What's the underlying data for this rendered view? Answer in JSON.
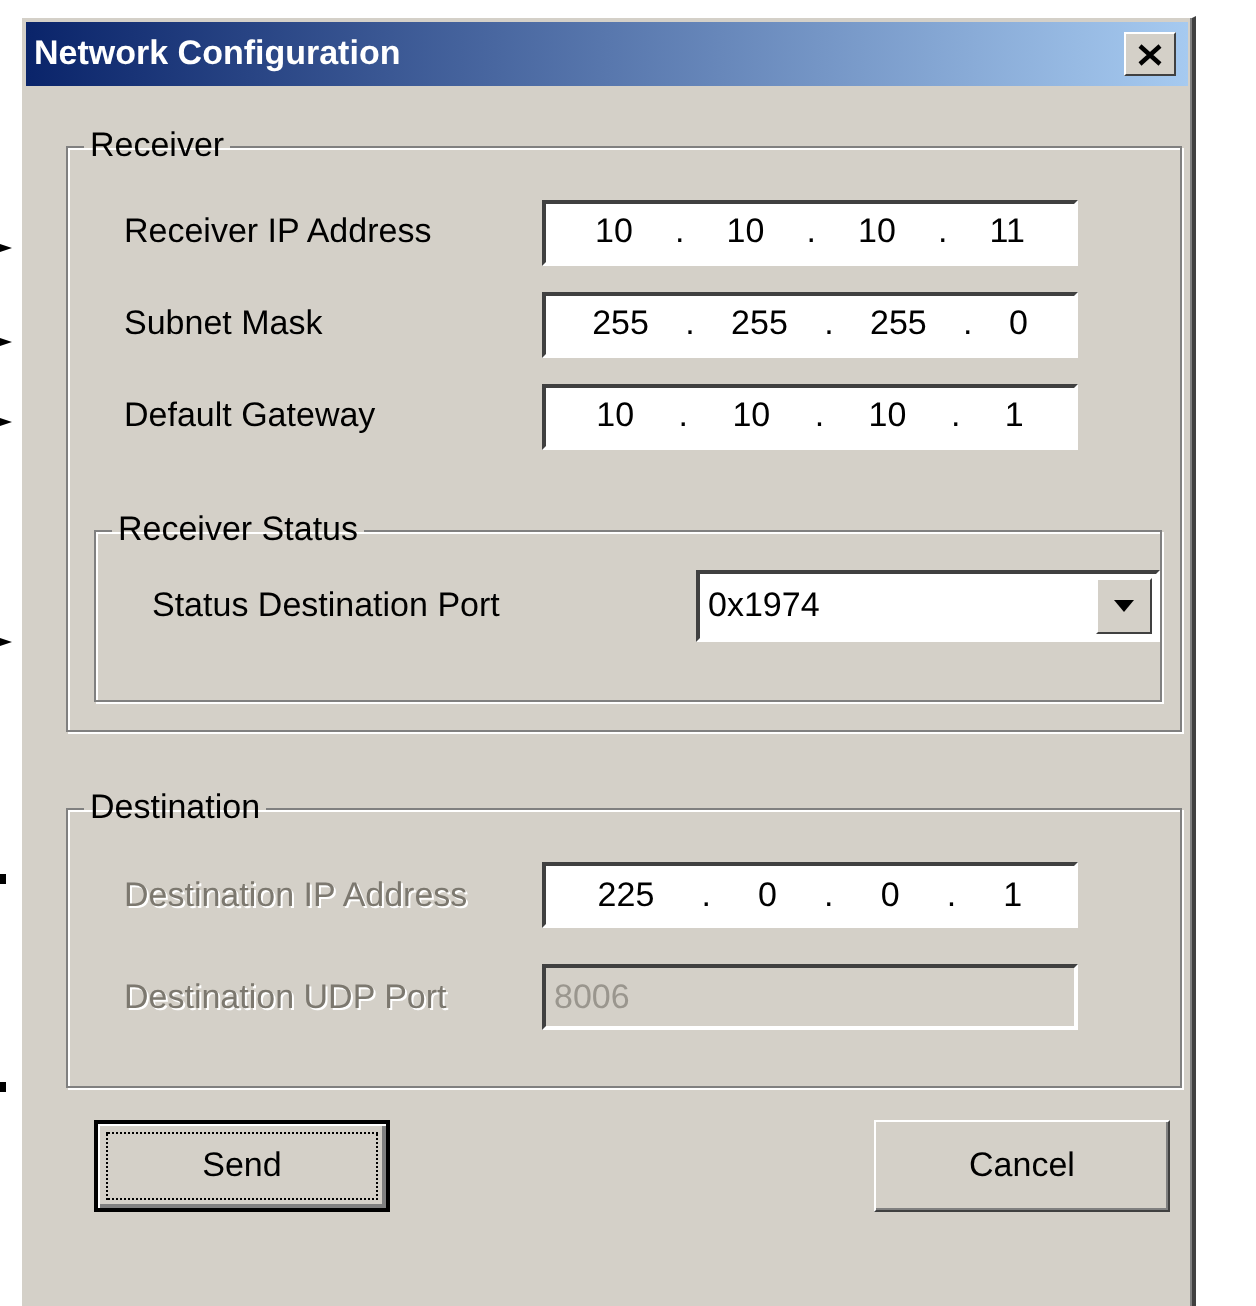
{
  "window": {
    "title": "Network Configuration"
  },
  "receiver": {
    "title": "Receiver",
    "fields": [
      {
        "label": "Receiver IP Address",
        "kind": "ip",
        "disabled": false,
        "parts": [
          "10",
          ".",
          "10",
          ".",
          "10",
          ".",
          "11"
        ]
      },
      {
        "label": "Subnet Mask",
        "kind": "ip",
        "disabled": false,
        "parts": [
          "255",
          ".",
          "255",
          ".",
          "255",
          ".",
          "0"
        ]
      },
      {
        "label": "Default Gateway",
        "kind": "ip",
        "disabled": false,
        "parts": [
          "10",
          ".",
          "10",
          ".",
          "10",
          ".",
          "1"
        ]
      }
    ],
    "status": {
      "title": "Receiver Status",
      "label": "Status Destination Port",
      "value": "0x1974"
    }
  },
  "destination": {
    "title": "Destination",
    "fields": [
      {
        "label": "Destination IP Address",
        "kind": "ip",
        "disabled": true,
        "parts": [
          "225",
          ".",
          "0",
          ".",
          "0",
          ".",
          "1"
        ]
      },
      {
        "label": "Destination UDP Port",
        "kind": "text",
        "disabled": true,
        "value": "8006"
      }
    ]
  },
  "buttons": [
    {
      "label": "Send",
      "default": true
    },
    {
      "label": "Cancel",
      "default": false
    }
  ]
}
